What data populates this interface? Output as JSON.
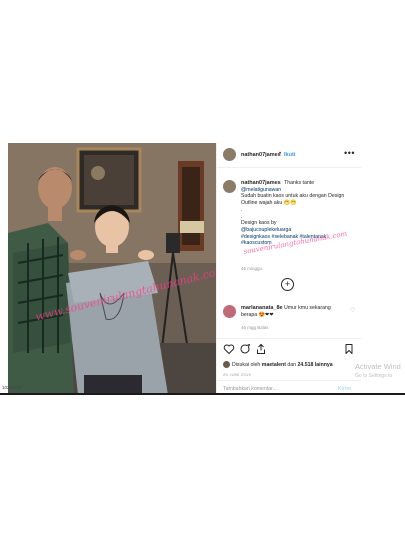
{
  "post": {
    "username": "nathan07james",
    "dot": "•",
    "follow_label": "Ikuti",
    "more_icon": "•••",
    "caption": {
      "username": "nathan07james",
      "line1": "Thanks tante",
      "mention1": "@melatigunawan",
      "line2": "Sudah buatin kaos untuk aku dengan Design Outline wajah aku 😁😁",
      "line3": ".",
      "line4": ".",
      "line5": "Design kaos by",
      "mention2": "@bajucouplekeluarga",
      "tags": "#designkaos #selebanak #talentanak",
      "tags_tail": "#kaoscustom",
      "time": "46 minggu"
    },
    "load_more": "+",
    "comment": {
      "username": "marlananata_8e",
      "text": "Umur kmu sekarang berapa 😍❤❤",
      "heart": "♡",
      "meta": "46 mgg   Balas"
    },
    "likes": {
      "prefix": "Disukai oleh",
      "liker": "maetalent",
      "middle": "dan",
      "count": "24.518 lainnya"
    },
    "date": "25 JUNI 2019",
    "comment_placeholder": "Tambahkan komentar...",
    "send_label": "Kirim"
  },
  "watermark": {
    "text_photo": "www.souvenirulangtahunanak.com",
    "text_caption": "souvenirulangtahunanak.com"
  },
  "windows_notice": {
    "title": "Activate Wind",
    "subtitle": "Go to Settings to"
  },
  "statusbar": {
    "tag": "1024x768 ^"
  },
  "colors": {
    "accent": "#3897f0",
    "watermark": "#ff3a8f"
  }
}
